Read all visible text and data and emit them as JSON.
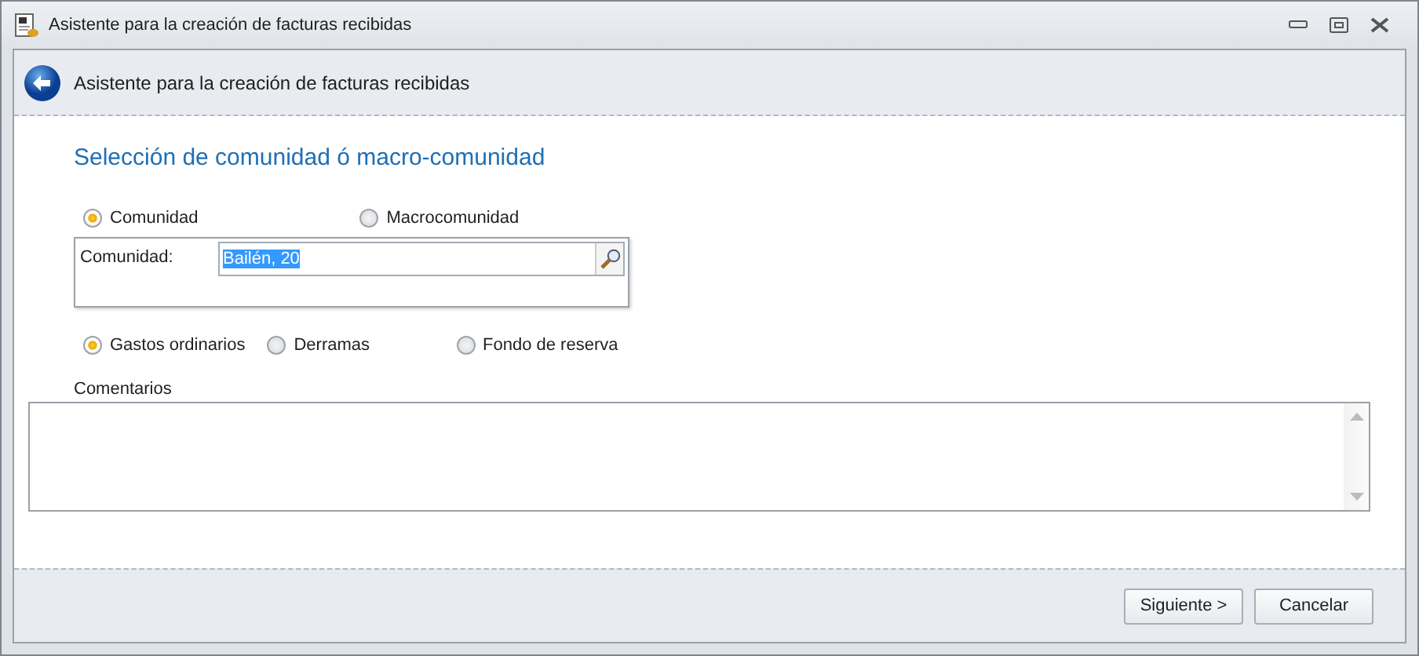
{
  "window": {
    "title": "Asistente para la creación de facturas recibidas"
  },
  "header": {
    "title": "Asistente para la creación de facturas recibidas"
  },
  "section_title": "Selección de comunidad ó macro-comunidad",
  "scope_options": [
    {
      "label": "Comunidad",
      "selected": true
    },
    {
      "label": "Macrocomunidad",
      "selected": false
    }
  ],
  "community_field": {
    "label": "Comunidad:",
    "value": "Bailén, 20"
  },
  "expense_options": [
    {
      "label": "Gastos ordinarios",
      "selected": true
    },
    {
      "label": "Derramas",
      "selected": false
    },
    {
      "label": "Fondo de reserva",
      "selected": false
    }
  ],
  "comments": {
    "label": "Comentarios"
  },
  "buttons": [
    {
      "label": "Siguiente >"
    },
    {
      "label": "Cancelar"
    }
  ]
}
